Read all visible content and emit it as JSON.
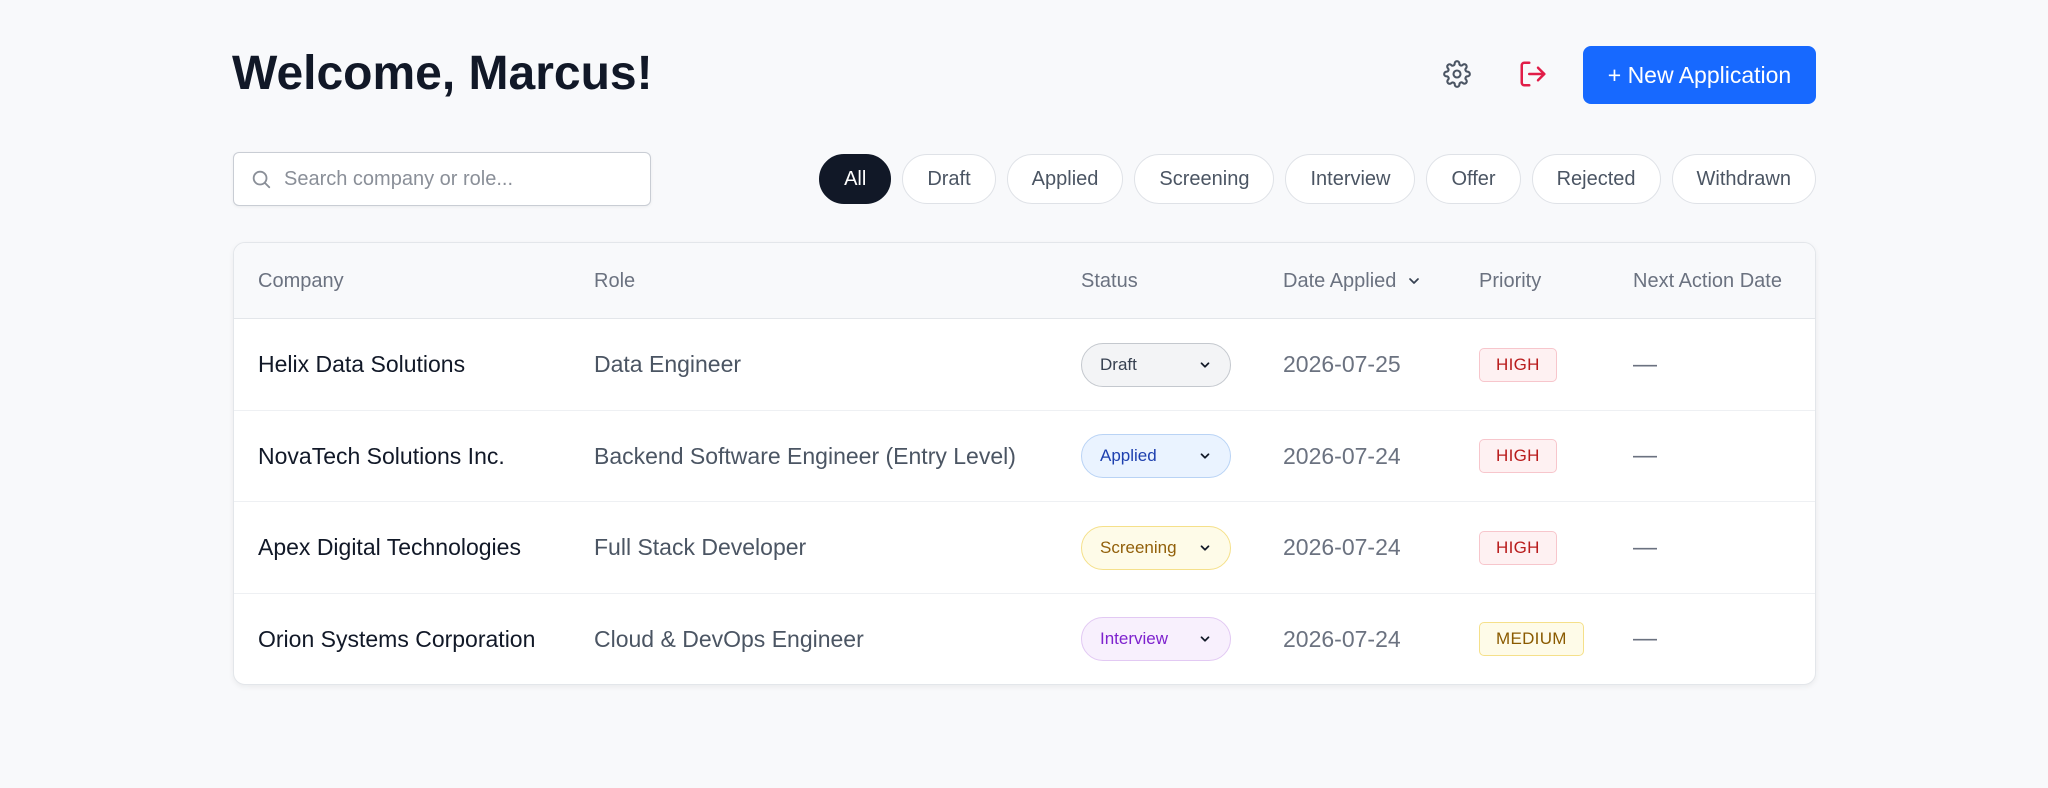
{
  "header": {
    "title": "Welcome, Marcus!",
    "settings_icon": "gear-icon",
    "logout_icon": "logout-icon",
    "new_application_label": "+ New Application"
  },
  "search": {
    "placeholder": "Search company or role...",
    "value": ""
  },
  "filters": {
    "active": "All",
    "items": [
      "All",
      "Draft",
      "Applied",
      "Screening",
      "Interview",
      "Offer",
      "Rejected",
      "Withdrawn"
    ]
  },
  "table": {
    "columns": {
      "company": "Company",
      "role": "Role",
      "status": "Status",
      "date_applied": "Date Applied",
      "priority": "Priority",
      "next_action_date": "Next Action Date"
    },
    "rows": [
      {
        "company": "Helix Data Solutions",
        "role": "Data Engineer",
        "status": "Draft",
        "date_applied": "2026-07-25",
        "priority": "HIGH",
        "next_action_date": "—"
      },
      {
        "company": "NovaTech Solutions Inc.",
        "role": "Backend Software Engineer (Entry Level)",
        "status": "Applied",
        "date_applied": "2026-07-24",
        "priority": "HIGH",
        "next_action_date": "—"
      },
      {
        "company": "Apex Digital Technologies",
        "role": "Full Stack Developer",
        "status": "Screening",
        "date_applied": "2026-07-24",
        "priority": "HIGH",
        "next_action_date": "—"
      },
      {
        "company": "Orion Systems Corporation",
        "role": "Cloud & DevOps Engineer",
        "status": "Interview",
        "date_applied": "2026-07-24",
        "priority": "MEDIUM",
        "next_action_date": "—"
      }
    ]
  },
  "colors": {
    "accent": "#1769ff",
    "logout": "#e11d48",
    "status": {
      "Draft": {
        "bg": "#f3f4f6",
        "border": "#c4c8ce",
        "text": "#374151"
      },
      "Applied": {
        "bg": "#eaf3ff",
        "border": "#b9d3f5",
        "text": "#1e40af"
      },
      "Screening": {
        "bg": "#fefbe8",
        "border": "#f5e08a",
        "text": "#92600a"
      },
      "Interview": {
        "bg": "#f8f0fd",
        "border": "#e2c9f3",
        "text": "#7e22ce"
      }
    },
    "priority": {
      "HIGH": {
        "bg": "#fef1f2",
        "border": "#f7c6cc",
        "text": "#b91c1c"
      },
      "MEDIUM": {
        "bg": "#fefbe8",
        "border": "#f5e08a",
        "text": "#8a5a00"
      }
    }
  }
}
